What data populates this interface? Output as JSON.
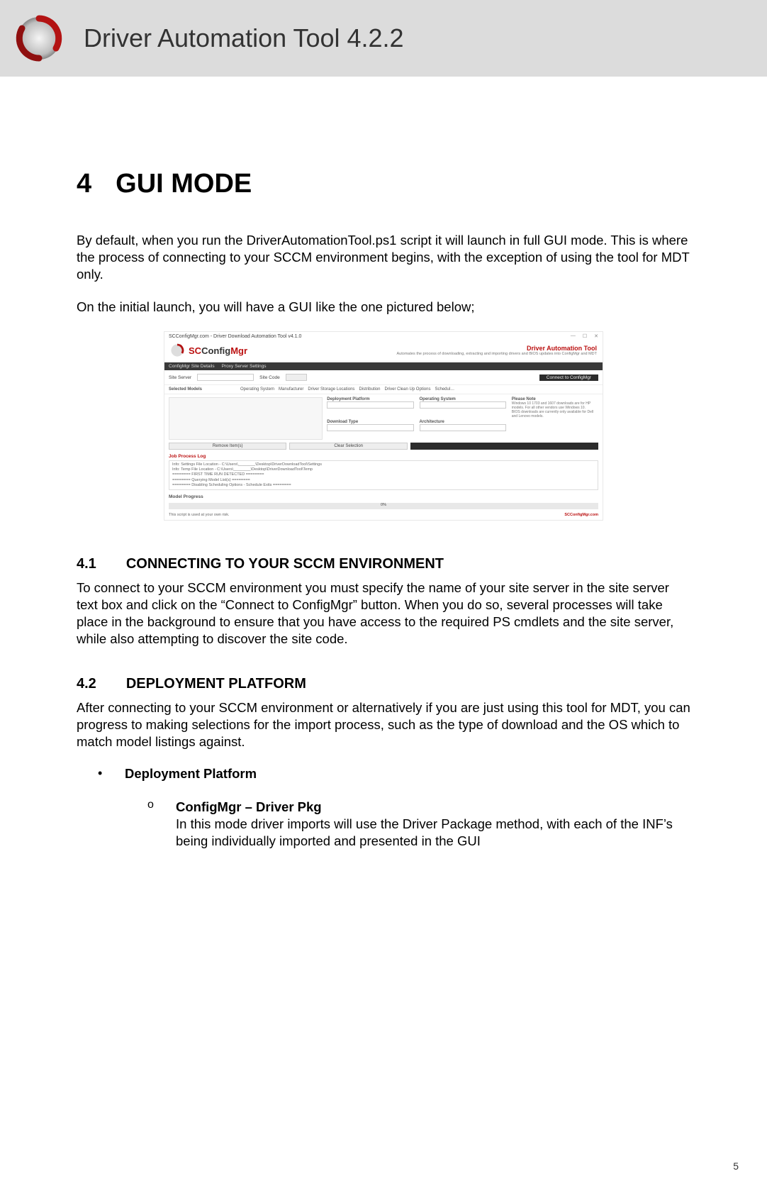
{
  "header": {
    "title": "Driver Automation Tool 4.2.2"
  },
  "section": {
    "num": "4",
    "title": "GUI MODE"
  },
  "intro": {
    "p1": "By default, when you run the DriverAutomationTool.ps1 script it will launch in full GUI mode. This is where the process of connecting to your SCCM environment begins, with the exception of using the tool for MDT only.",
    "p2": "On the initial launch, you will have a GUI like the one pictured below;"
  },
  "app": {
    "window_title": "SCConfigMgr.com - Driver Download Automation Tool v4.1.0",
    "brand_pre": "SC",
    "brand_mid": "Config",
    "brand_post": "Mgr",
    "hdr_t1": "Driver Automation Tool",
    "hdr_t2": "Automates the process of downloading, extracting and importing drivers and BIOS updates into ConfigMgr and MDT",
    "tabs_main": [
      "ConfigMgr Site Details",
      "Proxy Server Settings"
    ],
    "site_server_label": "Site Server",
    "site_code_label": "Site Code",
    "connect_btn": "Connect to ConfigMgr",
    "cols": [
      "Selected Models",
      "Operating System",
      "Manufacturer",
      "Driver Storage Locations",
      "Distribution",
      "Driver Clean Up Options",
      "Schedul…"
    ],
    "labels": {
      "dep_platform": "Deployment Platform",
      "op_sys": "Operating System",
      "dl_type": "Download Type",
      "arch": "Architecture",
      "please_note": "Please Note"
    },
    "note": "Windows 10 1703 and 1607 downloads are for HP models. For all other vendors use Windows 10.\nBIOS downloads are currently only available for Dell and Lenovo models.",
    "btns": {
      "remove": "Remove Item(s)",
      "clear": "Clear Selection",
      "start": ""
    },
    "job_log_title": "Job Process Log",
    "log": [
      "Info: Settings File Location - C:\\Users\\________\\Desktop\\DriverDownloadTool\\Settings",
      "Info: Temp File Location - C:\\Users\\________\\Desktop\\DriverDownloadTool\\Temp",
      "======== FIRST TIME RUN DETECTED ========",
      "======== Querying Model List(s) ========",
      "======== Disabling Scheduling Options - Schedule Exits ========"
    ],
    "model_progress": "Model Progress",
    "progress_pct": "0%",
    "footer_left": "This script is used at your own risk.",
    "footer_right": "SCConfigMgr.com"
  },
  "s41": {
    "num": "4.1",
    "title": "CONNECTING TO YOUR SCCM ENVIRONMENT",
    "body": "To connect to your SCCM environment you must specify the name of your site server in the site server text box and click on the “Connect to ConfigMgr” button. When you do so, several processes will take place in the background to ensure that you have access to the required PS cmdlets and the site server, while also attempting to discover the site code."
  },
  "s42": {
    "num": "4.2",
    "title": "DEPLOYMENT PLATFORM",
    "body": "After connecting to your SCCM environment or alternatively if you are just using this tool for MDT, you can progress to making selections for the import process, such as the type of download and the OS which to match model listings against.",
    "bullet": "Deployment Platform",
    "sub_mark": "o",
    "sub_title": "ConfigMgr – Driver Pkg",
    "sub_body": "In this mode driver imports will use the Driver Package method, with each of the INF’s being individually imported and presented in the GUI"
  },
  "page_number": "5"
}
